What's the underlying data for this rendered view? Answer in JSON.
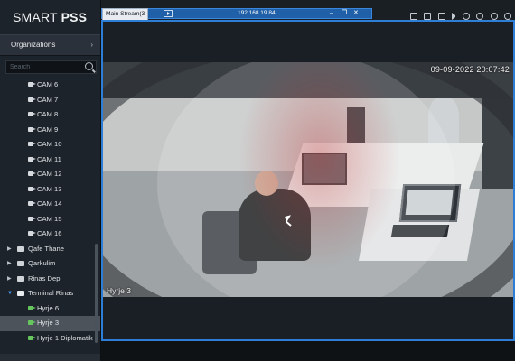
{
  "app": {
    "name_part1": "SMART",
    "name_part2": "PSS"
  },
  "sidebar": {
    "organizations_label": "Organizations",
    "search_placeholder": "Search",
    "tree": [
      {
        "type": "camera",
        "label": "CAM 6"
      },
      {
        "type": "camera",
        "label": "CAM 7"
      },
      {
        "type": "camera",
        "label": "CAM 8"
      },
      {
        "type": "camera",
        "label": "CAM 9"
      },
      {
        "type": "camera",
        "label": "CAM 10"
      },
      {
        "type": "camera",
        "label": "CAM 11"
      },
      {
        "type": "camera",
        "label": "CAM 12"
      },
      {
        "type": "camera",
        "label": "CAM 13"
      },
      {
        "type": "camera",
        "label": "CAM 14"
      },
      {
        "type": "camera",
        "label": "CAM 15"
      },
      {
        "type": "camera",
        "label": "CAM 16"
      },
      {
        "type": "group",
        "label": "Qafe Thane",
        "expanded": false
      },
      {
        "type": "group",
        "label": "Qarkulim",
        "expanded": false
      },
      {
        "type": "group",
        "label": "Rinas Dep",
        "expanded": false
      },
      {
        "type": "group",
        "label": "Terminal Rinas",
        "expanded": true
      },
      {
        "type": "channel",
        "label": "Hyrje 6",
        "selected": false
      },
      {
        "type": "channel",
        "label": "Hyrje 3",
        "selected": true
      },
      {
        "type": "channel",
        "label": "Hyrje 1 Diplomatik",
        "selected": false
      }
    ]
  },
  "toolbar": {
    "stream_tab_label": "Main Stream(3",
    "ip_address": "192.168.19.84",
    "minimize_label": "–",
    "restore_label": "❐",
    "close_label": "✕"
  },
  "video": {
    "timestamp": "09-09-2022 20:07:42",
    "channel_label": "Hyrje 3"
  },
  "colors": {
    "accent": "#2f7ed6",
    "channel_online": "#67c55e"
  }
}
